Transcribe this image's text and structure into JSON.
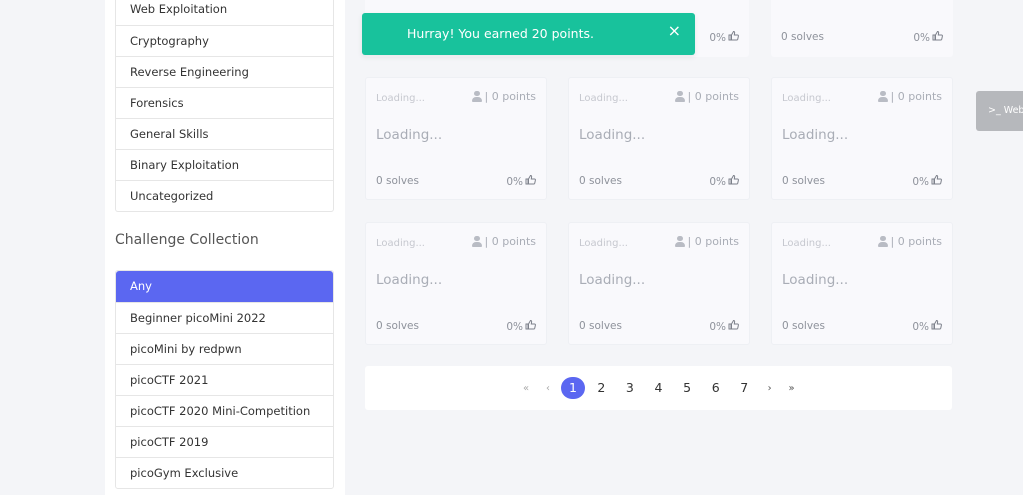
{
  "categories": [
    {
      "label": "Web Exploitation"
    },
    {
      "label": "Cryptography"
    },
    {
      "label": "Reverse Engineering"
    },
    {
      "label": "Forensics"
    },
    {
      "label": "General Skills"
    },
    {
      "label": "Binary Exploitation"
    },
    {
      "label": "Uncategorized"
    }
  ],
  "collection": {
    "title": "Challenge Collection",
    "items": [
      {
        "label": "Any",
        "active": true
      },
      {
        "label": "Beginner picoMini 2022"
      },
      {
        "label": "picoMini by redpwn"
      },
      {
        "label": "picoCTF 2021"
      },
      {
        "label": "picoCTF 2020 Mini-Competition"
      },
      {
        "label": "picoCTF 2019"
      },
      {
        "label": "picoGym Exclusive"
      }
    ]
  },
  "toast": {
    "message": "Hurray! You earned 20 points.",
    "close": "×",
    "color": "#18c29c"
  },
  "top_cards": [
    {
      "solves": "",
      "likes": "0%"
    },
    {
      "solves": "0 solves",
      "likes": "0%"
    }
  ],
  "cards": [
    {
      "category": "Loading...",
      "points": "| 0 points",
      "title": "Loading...",
      "solves": "0 solves",
      "likes": "0%"
    },
    {
      "category": "Loading...",
      "points": "| 0 points",
      "title": "Loading...",
      "solves": "0 solves",
      "likes": "0%"
    },
    {
      "category": "Loading...",
      "points": "| 0 points",
      "title": "Loading...",
      "solves": "0 solves",
      "likes": "0%"
    },
    {
      "category": "Loading...",
      "points": "| 0 points",
      "title": "Loading...",
      "solves": "0 solves",
      "likes": "0%"
    },
    {
      "category": "Loading...",
      "points": "| 0 points",
      "title": "Loading...",
      "solves": "0 solves",
      "likes": "0%"
    },
    {
      "category": "Loading...",
      "points": "| 0 points",
      "title": "Loading...",
      "solves": "0 solves",
      "likes": "0%"
    }
  ],
  "pagination": {
    "first": "«",
    "prev": "‹",
    "pages": [
      "1",
      "2",
      "3",
      "4",
      "5",
      "6",
      "7"
    ],
    "current": "1",
    "next": "›",
    "last": "»"
  },
  "side_tab": {
    "label": ">_ Web"
  },
  "colors": {
    "accent": "#5b67f1",
    "success": "#18c29c"
  }
}
